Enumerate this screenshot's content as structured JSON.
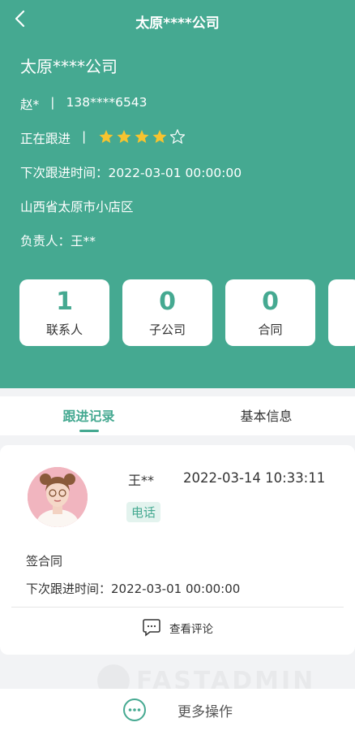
{
  "nav": {
    "title": "太原****公司"
  },
  "company": {
    "name": "太原****公司",
    "contact_name": "赵*",
    "separator": "|",
    "phone": "138****6543",
    "status": "正在跟进",
    "rating": 4,
    "rating_max": 5,
    "next_followup": "下次跟进时间：2022-03-01 00:00:00",
    "address": "山西省太原市小店区",
    "owner": "负责人：王**"
  },
  "stats": [
    {
      "value": "1",
      "label": "联系人"
    },
    {
      "value": "0",
      "label": "子公司"
    },
    {
      "value": "0",
      "label": "合同"
    }
  ],
  "tabs": [
    {
      "label": "跟进记录",
      "active": true
    },
    {
      "label": "基本信息",
      "active": false
    }
  ],
  "record": {
    "author": "王**",
    "time": "2022-03-14 10:33:11",
    "type": "电话",
    "content": "签合同",
    "next_time": "下次跟进时间：2022-03-01 00:00:00",
    "comment_label": "查看评论"
  },
  "watermark": "FASTADMIN",
  "footer": {
    "more_label": "更多操作"
  },
  "colors": {
    "brand": "#45a991",
    "star": "#f7c42f"
  }
}
